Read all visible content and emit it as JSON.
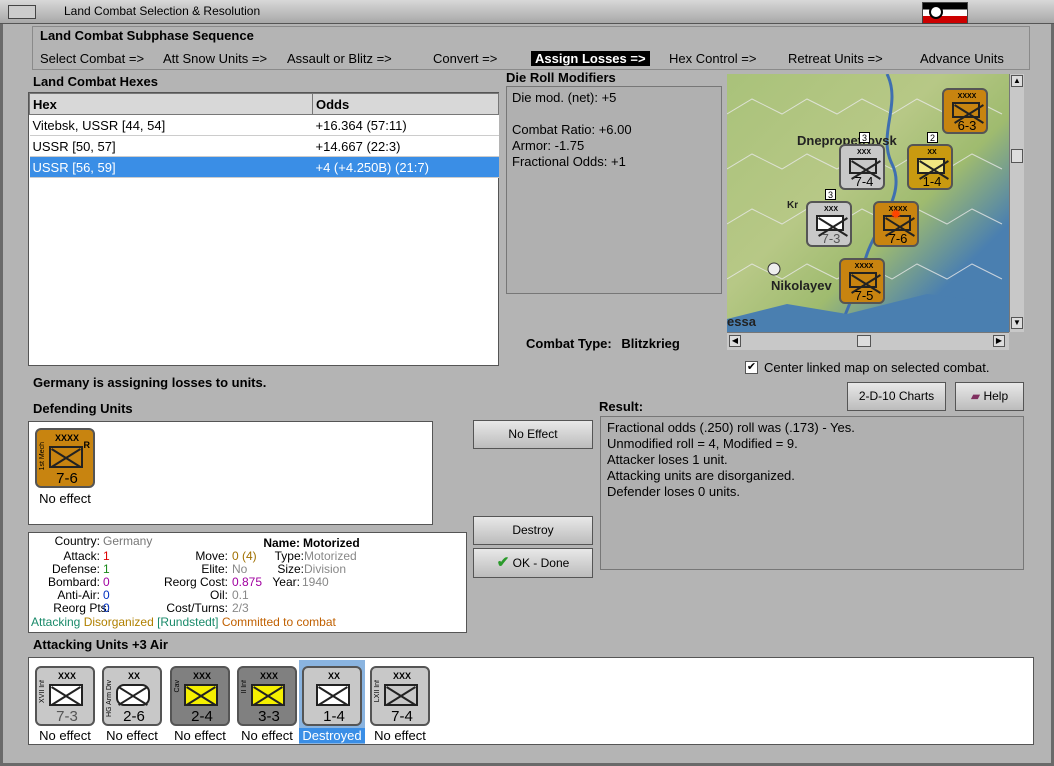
{
  "window": {
    "title": "Land Combat Selection & Resolution"
  },
  "subphase": {
    "header": "Land Combat Subphase Sequence",
    "steps": [
      "Select Combat =>",
      "Att Snow Units =>",
      "Assault or Blitz =>",
      "Convert =>",
      "Assign Losses =>",
      "Hex Control =>",
      "Retreat Units =>",
      "Advance Units"
    ],
    "active_index": 4
  },
  "hexes": {
    "header": "Land Combat Hexes",
    "columns": [
      "Hex",
      "Odds"
    ],
    "rows": [
      {
        "hex": "Vitebsk, USSR [44, 54]",
        "odds": "+16.364 (57:11)"
      },
      {
        "hex": "USSR [50, 57]",
        "odds": "+14.667 (22:3)"
      },
      {
        "hex": "USSR [56, 59]",
        "odds": "+4 (+4.250B) (21:7)"
      }
    ],
    "selected_index": 2
  },
  "modifiers": {
    "header": "Die Roll Modifiers",
    "lines": [
      "Die mod. (net): +5",
      "",
      "Combat Ratio: +6.00",
      "Armor: -1.75",
      "Fractional Odds: +1"
    ]
  },
  "combat_type": {
    "label": "Combat Type:",
    "value": "Blitzkrieg"
  },
  "map": {
    "cities": [
      "Dnepropetrovsk",
      "Kr",
      "Nikolayev",
      "essa"
    ],
    "units": [
      {
        "val": "6-3",
        "size": "XXXX",
        "color": "orange"
      },
      {
        "val": "7-4",
        "size": "XXX",
        "color": "grey"
      },
      {
        "val": "1-4",
        "size": "XX",
        "color": "yellow"
      },
      {
        "val": "7-3",
        "size": "XXX",
        "color": "grey"
      },
      {
        "val": "7-6",
        "size": "XXXX",
        "color": "orange"
      },
      {
        "val": "7-5",
        "size": "XXXX",
        "color": "orange"
      }
    ],
    "stack_counts": [
      "3",
      "2",
      "3"
    ],
    "center_checkbox_label": "Center linked map on selected combat.",
    "center_checked": true
  },
  "status": "Germany is assigning losses to units.",
  "defending": {
    "header": "Defending Units",
    "units": [
      {
        "val": "7-6",
        "size": "XXXX",
        "side": "1st Mech",
        "corner": "R",
        "label": "No effect",
        "color": "orange"
      }
    ]
  },
  "buttons": {
    "no_effect": "No Effect",
    "destroy": "Destroy",
    "ok_done": "OK - Done",
    "charts": "2-D-10 Charts",
    "help": "Help"
  },
  "result": {
    "header": "Result:",
    "lines": [
      "Fractional odds (.250) roll was (.173)  - Yes.",
      "Unmodified roll = 4, Modified = 9.",
      "Attacker loses 1 unit.",
      "Attacking units are disorganized.",
      "Defender loses 0 units."
    ]
  },
  "unit_info": {
    "country_lbl": "Country:",
    "country": "Germany",
    "name_lbl": "Name:",
    "name": "Motorized",
    "attack_lbl": "Attack:",
    "attack": "1",
    "move_lbl": "Move:",
    "move": "0 (4)",
    "type_lbl": "Type:",
    "type": "Motorized",
    "defense_lbl": "Defense:",
    "defense": "1",
    "elite_lbl": "Elite:",
    "elite": "No",
    "size_lbl": "Size:",
    "size": "Division",
    "bombard_lbl": "Bombard:",
    "bombard": "0",
    "reorg_cost_lbl": "Reorg Cost:",
    "reorg_cost": "0.875",
    "year_lbl": "Year:",
    "year": "1940",
    "anti_air_lbl": "Anti-Air:",
    "anti_air": "0",
    "oil_lbl": "Oil:",
    "oil": "0.1",
    "reorg_pts_lbl": "Reorg Pts:",
    "reorg_pts": "0",
    "cost_turns_lbl": "Cost/Turns:",
    "cost_turns": "2/3",
    "status_attacking": "Attacking",
    "status_disorganized": "Disorganized",
    "status_hq": "[Rundstedt]",
    "status_committed": "Committed to combat"
  },
  "attacking": {
    "header": "Attacking Units +3 Air",
    "units": [
      {
        "val": "7-3",
        "size": "XXX",
        "side": "XVII Inf",
        "label": "No effect",
        "color": "grey"
      },
      {
        "val": "2-6",
        "size": "XX",
        "side": "HG Arm Div",
        "label": "No effect",
        "color": "grey"
      },
      {
        "val": "2-4",
        "size": "XXX",
        "side": "Cav",
        "label": "No effect",
        "color": "dgrey"
      },
      {
        "val": "3-3",
        "size": "XXX",
        "side": "II Inf",
        "label": "No effect",
        "color": "dgrey"
      },
      {
        "val": "1-4",
        "size": "XX",
        "side": "",
        "label": "Destroyed",
        "color": "grey"
      },
      {
        "val": "7-4",
        "size": "XXX",
        "side": "LXII Inf",
        "label": "No effect",
        "color": "grey"
      }
    ],
    "selected_index": 4
  }
}
